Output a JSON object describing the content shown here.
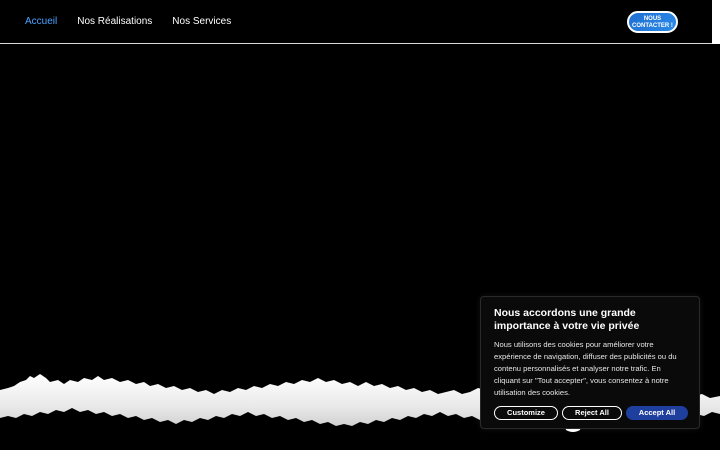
{
  "header": {
    "nav": [
      {
        "label": "Accueil",
        "active": true
      },
      {
        "label": "Nos Réalisations",
        "active": false
      },
      {
        "label": "Nos Services",
        "active": false
      }
    ],
    "contact_line1": "NOUS",
    "contact_line2": "CONTACTER !"
  },
  "cookie": {
    "title": "Nous accordons une grande importance à votre vie privée",
    "text": "Nous utilisons des cookies pour améliorer votre expérience de navigation, diffuser des publicités ou du contenu personnalisés et analyser notre trafic. En cliquant sur \"Tout accepter\", vous consentez à notre utilisation des cookies.",
    "customize_label": "Customize",
    "reject_label": "Reject All",
    "accept_label": "Accept All"
  },
  "colors": {
    "background": "#000000",
    "nav_active": "#4aa3ff",
    "accept_button": "#1f3f9e",
    "contact_button": "#1f6fd1"
  }
}
